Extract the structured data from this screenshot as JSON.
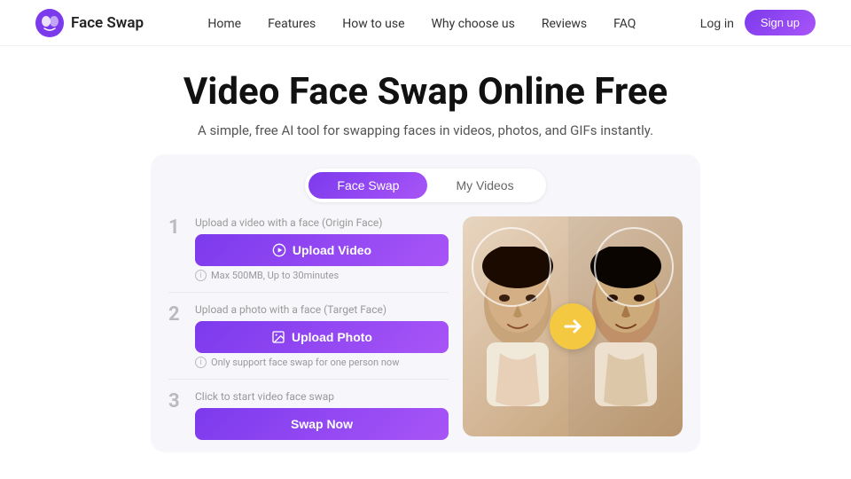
{
  "nav": {
    "logo_text": "Face Swap",
    "links": [
      {
        "label": "Home",
        "id": "home"
      },
      {
        "label": "Features",
        "id": "features"
      },
      {
        "label": "How to use",
        "id": "how-to-use"
      },
      {
        "label": "Why choose us",
        "id": "why-choose"
      },
      {
        "label": "Reviews",
        "id": "reviews"
      },
      {
        "label": "FAQ",
        "id": "faq"
      }
    ],
    "login_label": "Log in",
    "signup_label": "Sign up"
  },
  "hero": {
    "title": "Video Face Swap Online Free",
    "subtitle": "A simple, free AI tool for swapping faces in videos, photos, and GIFs instantly."
  },
  "tabs": [
    {
      "label": "Face Swap",
      "id": "face-swap",
      "active": true
    },
    {
      "label": "My Videos",
      "id": "my-videos",
      "active": false
    }
  ],
  "steps": [
    {
      "num": "1",
      "label": "Upload a video with a face",
      "label_suffix": "(Origin Face)",
      "btn_label": "Upload Video",
      "hint": "Max 500MB, Up to 30minutes",
      "icon": "▶"
    },
    {
      "num": "2",
      "label": "Upload a photo with a face",
      "label_suffix": "(Target Face)",
      "btn_label": "Upload Photo",
      "hint": "Only support face swap for one person now",
      "icon": "🖼"
    },
    {
      "num": "3",
      "label": "Click to start video face swap",
      "label_suffix": "",
      "btn_label": "Swap Now",
      "hint": "",
      "icon": ""
    }
  ]
}
